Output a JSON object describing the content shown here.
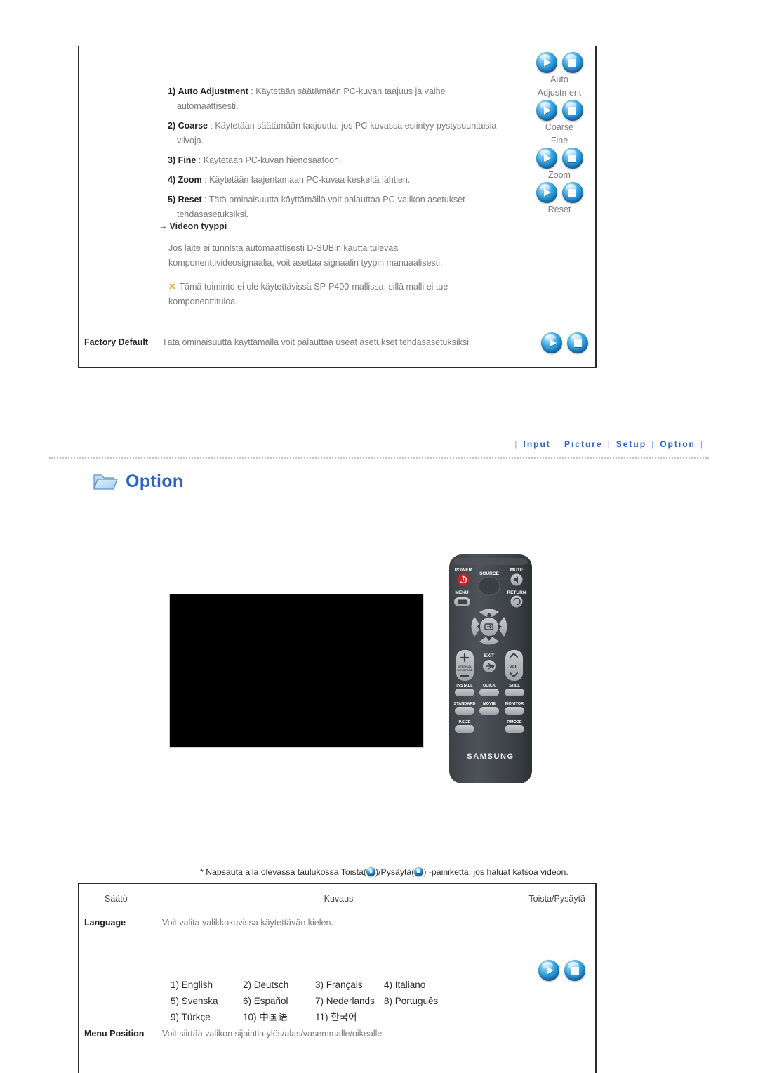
{
  "top_panel": {
    "pc_items": [
      {
        "index": "1)",
        "term": "Auto Adjustment",
        "sep": " : ",
        "desc": "Käytetään säätämään PC-kuvan taajuus ja vaihe",
        "desc2": "automaattisesti."
      },
      {
        "index": "2)",
        "term": "Coarse",
        "sep": " : ",
        "desc": "Käytetään säätämään taajuutta, jos PC-kuvassa esiintyy pystysuuntaisia",
        "desc2": "viivoja."
      },
      {
        "index": "3)",
        "term": "Fine",
        "sep": " : ",
        "desc": "Käytetään PC-kuvan hienosäätöön.",
        "desc2": ""
      },
      {
        "index": "4)",
        "term": "Zoom",
        "sep": " : ",
        "desc": "Käytetään laajentamaan PC-kuvaa keskeltä lähtien.",
        "desc2": ""
      },
      {
        "index": "5)",
        "term": "Reset",
        "sep": " : ",
        "desc": "Tätä ominaisuutta käyttämällä voit palauttaa PC-valikon asetukset",
        "desc2": "tehdasasetuksiksi."
      }
    ],
    "video_type": {
      "arrow": "→",
      "heading": "Videon tyyppi",
      "body_line1": "Jos laite ei tunnista automaattisesti D-SUBin kautta tulevaa",
      "body_line2": "komponenttivideosignaalia, voit asettaa signaalin tyypin manuaalisesti.",
      "note_mark": "✕",
      "note_line1": "Tämä toiminto ei ole käytettävissä SP-P400-mallissa, sillä malli ei tue",
      "note_line2": "komponenttituloa."
    },
    "right_labels": [
      "Auto",
      "Adjustment",
      "Coarse",
      "Fine",
      "Zoom",
      "Reset"
    ],
    "factory_default": {
      "name": "Factory Default",
      "desc": "Tätä ominaisuutta käyttämällä voit palauttaa useat asetukset tehdasasetuksiksi."
    }
  },
  "nav": {
    "separator": "|",
    "items": [
      {
        "label": "Input"
      },
      {
        "label": "Picture"
      },
      {
        "label": "Setup"
      },
      {
        "label": "Option"
      }
    ]
  },
  "section": {
    "icon": "folder-icon",
    "title": "Option"
  },
  "media": {
    "video_caption": "",
    "remote": {
      "brand": "SAMSUNG",
      "buttons": [
        "POWER",
        "SOURCE",
        "MUTE",
        "MENU",
        "RETURN",
        "EXIT",
        "VOL",
        "VERTICAL KEYSTONE",
        "INSTALL",
        "QUICK",
        "STILL",
        "STANDARD",
        "MOVIE",
        "MONITOR",
        "P.SIZE",
        "P.MODE"
      ]
    }
  },
  "note": {
    "prefix": "* Napsauta alla olevassa taulukossa Toista(",
    "mid": ")/Pysäytä(",
    "suffix": ") -painiketta, jos haluat katsoa videon."
  },
  "bottom_table": {
    "headers": [
      "Säätö",
      "Kuvaus",
      "Toista/Pysäytä"
    ],
    "rows": [
      {
        "name": "Language",
        "desc": "Voit valita valikkokuvissa käytettävän kielen."
      },
      {
        "name": "Menu Position",
        "desc": "Voit siirtää valikon sijaintia ylös/alas/vasemmalle/oikealle."
      }
    ],
    "languages": [
      [
        "1) English",
        "2) Deutsch",
        "3) Français",
        "4) Italiano"
      ],
      [
        "5) Svenska",
        "6) Español",
        "7) Nederlands",
        "8) Português"
      ],
      [
        "9) Türkçe",
        "10) 中国语",
        "11) 한국어",
        ""
      ]
    ]
  },
  "colors": {
    "accent_blue": "#2b63c6",
    "button_blue": "#2f9fe0",
    "border_dark": "#2b2b2b",
    "body_text": "#7a7a7a",
    "warn_orange": "#f0a030"
  }
}
